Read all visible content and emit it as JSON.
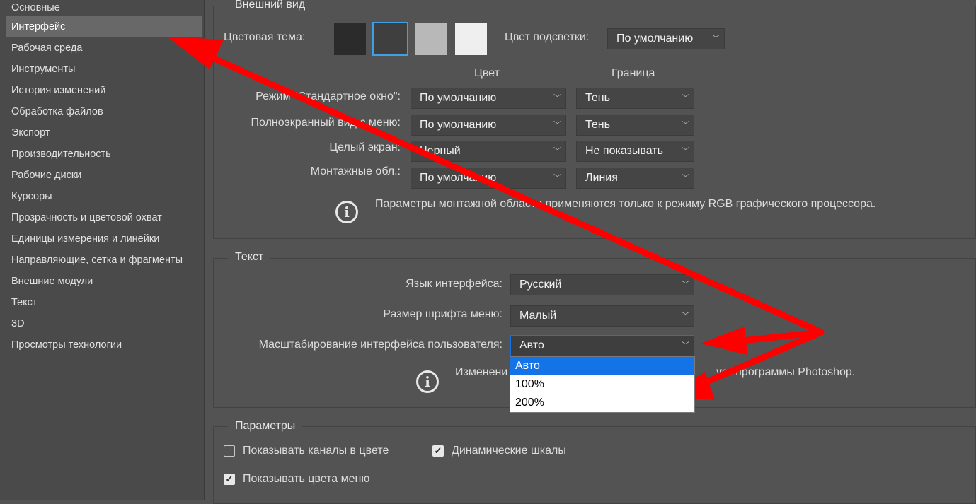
{
  "sidebar": {
    "items": [
      {
        "label": "Основные"
      },
      {
        "label": "Интерфейс"
      },
      {
        "label": "Рабочая среда"
      },
      {
        "label": "Инструменты"
      },
      {
        "label": "История изменений"
      },
      {
        "label": "Обработка файлов"
      },
      {
        "label": "Экспорт"
      },
      {
        "label": "Производительность"
      },
      {
        "label": "Рабочие диски"
      },
      {
        "label": "Курсоры"
      },
      {
        "label": "Прозрачность и цветовой охват"
      },
      {
        "label": "Единицы измерения и линейки"
      },
      {
        "label": "Направляющие, сетка и фрагменты"
      },
      {
        "label": "Внешние модули"
      },
      {
        "label": "Текст"
      },
      {
        "label": "3D"
      },
      {
        "label": "Просмотры технологии"
      }
    ],
    "selected": "Интерфейс"
  },
  "appearance": {
    "title": "Внешний вид",
    "color_theme_label": "Цветовая тема:",
    "swatches": [
      "#2b2b2b",
      "#3f3f3f",
      "#b8b8b8",
      "#efefef"
    ],
    "highlight_label": "Цвет подсветки:",
    "highlight_value": "По умолчанию",
    "col_color": "Цвет",
    "col_border": "Граница",
    "rows": [
      {
        "label": "Режим \"Стандартное окно\":",
        "color": "По умолчанию",
        "border": "Тень"
      },
      {
        "label": "Полноэкранный вид с меню:",
        "color": "По умолчанию",
        "border": "Тень"
      },
      {
        "label": "Целый экран:",
        "color": "Черный",
        "border": "Не показывать"
      },
      {
        "label": "Монтажные обл.:",
        "color": "По умолчанию",
        "border": "Линия"
      }
    ],
    "info": "Параметры монтажной области применяются только к режиму RGB графического процессора."
  },
  "text_section": {
    "title": "Текст",
    "language_label": "Язык интерфейса:",
    "language_value": "Русский",
    "font_size_label": "Размер шрифта меню:",
    "font_size_value": "Малый",
    "scale_label": "Масштабирование интерфейса пользователя:",
    "scale_value": "Авто",
    "scale_options": [
      "Авто",
      "100%",
      "200%"
    ],
    "info_start": "Изменени",
    "info_end": "уск программы Photoshop."
  },
  "params": {
    "title": "Параметры",
    "show_channels_color": {
      "label": "Показывать каналы в цвете",
      "checked": false
    },
    "dynamic_sliders": {
      "label": "Динамические шкалы",
      "checked": true
    },
    "show_menu_colors": {
      "label": "Показывать цвета меню",
      "checked": true
    }
  },
  "colors": {
    "accent": "#1473e6",
    "annotation_arrow": "#ff0000"
  }
}
